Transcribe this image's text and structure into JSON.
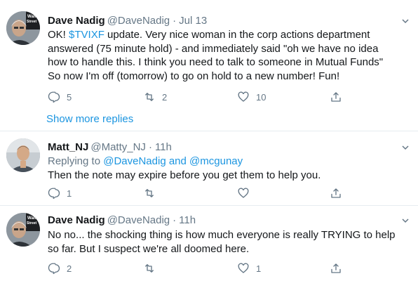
{
  "tweets": [
    {
      "name": "Dave Nadig",
      "handle": "@DaveNadig",
      "time": "Jul 13",
      "text_parts": [
        "OK! ",
        "$TVIXF",
        " update.  Very nice woman in the corp actions department answered (75 minute hold) - and immediately said \"oh we have no idea how to handle this.  I think you need to talk to someone in Mutual Funds\"  So now I'm off (tomorrow) to go on hold to a new number!  Fun!"
      ],
      "replies": "5",
      "retweets": "2",
      "likes": "10"
    },
    {
      "name": "Matt_NJ",
      "handle": "@Matty_NJ",
      "time": "11h",
      "replying_prefix": "Replying to ",
      "replying_to_1": "@DaveNadig",
      "replying_and": " and ",
      "replying_to_2": "@mcgunay",
      "text": "Then the note may expire before you get them to help you.",
      "replies": "1",
      "retweets": "",
      "likes": ""
    },
    {
      "name": "Dave Nadig",
      "handle": "@DaveNadig",
      "time": "11h",
      "text": "No no... the shocking thing is how much everyone is really TRYING  to help so far.  But I suspect we're all doomed here.",
      "replies": "2",
      "retweets": "",
      "likes": "1"
    }
  ],
  "show_more": "Show more replies",
  "dot": "·",
  "avatar_wall_text": [
    "Wall",
    "Street"
  ],
  "colors": {
    "link": "#1b95e0",
    "muted": "#657786",
    "text": "#14171a",
    "divider": "#e6ecf0"
  },
  "icons": [
    "reply-icon",
    "retweet-icon",
    "like-icon",
    "share-icon",
    "chevron-down-icon"
  ]
}
